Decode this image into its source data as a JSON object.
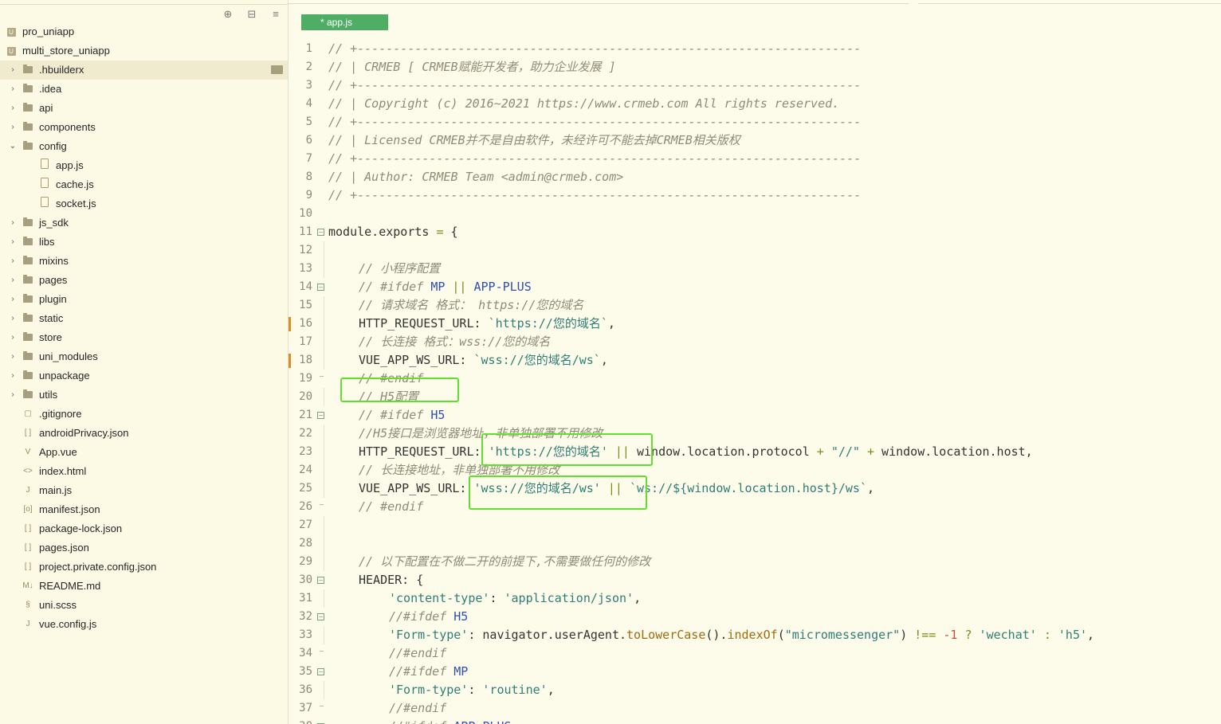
{
  "sidebar": {
    "tools": [
      "⊕",
      "⊟",
      "≡"
    ],
    "tree": [
      {
        "label": "pro_uniapp",
        "type": "project",
        "depth": 0
      },
      {
        "label": "multi_store_uniapp",
        "type": "project",
        "depth": 0
      },
      {
        "label": ".hbuilderx",
        "type": "folder",
        "depth": 1,
        "selected": true
      },
      {
        "label": ".idea",
        "type": "folder",
        "depth": 1
      },
      {
        "label": "api",
        "type": "folder",
        "depth": 1
      },
      {
        "label": "components",
        "type": "folder",
        "depth": 1
      },
      {
        "label": "config",
        "type": "folder",
        "depth": 1,
        "open": true
      },
      {
        "label": "app.js",
        "type": "file",
        "depth": 2
      },
      {
        "label": "cache.js",
        "type": "file",
        "depth": 2
      },
      {
        "label": "socket.js",
        "type": "file",
        "depth": 2
      },
      {
        "label": "js_sdk",
        "type": "folder",
        "depth": 1
      },
      {
        "label": "libs",
        "type": "folder",
        "depth": 1
      },
      {
        "label": "mixins",
        "type": "folder",
        "depth": 1
      },
      {
        "label": "pages",
        "type": "folder",
        "depth": 1
      },
      {
        "label": "plugin",
        "type": "folder",
        "depth": 1
      },
      {
        "label": "static",
        "type": "folder",
        "depth": 1
      },
      {
        "label": "store",
        "type": "folder",
        "depth": 1
      },
      {
        "label": "uni_modules",
        "type": "folder",
        "depth": 1
      },
      {
        "label": "unpackage",
        "type": "folder",
        "depth": 1
      },
      {
        "label": "utils",
        "type": "folder",
        "depth": 1
      },
      {
        "label": ".gitignore",
        "type": "file",
        "depth": 1,
        "icon": "▢"
      },
      {
        "label": "androidPrivacy.json",
        "type": "file",
        "depth": 1,
        "icon": "[ ]"
      },
      {
        "label": "App.vue",
        "type": "file",
        "depth": 1,
        "icon": "V"
      },
      {
        "label": "index.html",
        "type": "file",
        "depth": 1,
        "icon": "<>"
      },
      {
        "label": "main.js",
        "type": "file",
        "depth": 1,
        "icon": "J"
      },
      {
        "label": "manifest.json",
        "type": "file",
        "depth": 1,
        "icon": "[o]"
      },
      {
        "label": "package-lock.json",
        "type": "file",
        "depth": 1,
        "icon": "[ ]"
      },
      {
        "label": "pages.json",
        "type": "file",
        "depth": 1,
        "icon": "[ ]"
      },
      {
        "label": "project.private.config.json",
        "type": "file",
        "depth": 1,
        "icon": "[ ]"
      },
      {
        "label": "README.md",
        "type": "file",
        "depth": 1,
        "icon": "M↓"
      },
      {
        "label": "uni.scss",
        "type": "file",
        "depth": 1,
        "icon": "§"
      },
      {
        "label": "vue.config.js",
        "type": "file",
        "depth": 1,
        "icon": "J"
      }
    ]
  },
  "editor": {
    "tab_label": "* app.js",
    "lines": [
      {
        "n": "1",
        "indent": 0,
        "tokens": [
          [
            "c",
            "// +----------------------------------------------------------------------"
          ]
        ]
      },
      {
        "n": "2",
        "indent": 0,
        "tokens": [
          [
            "c",
            "// | CRMEB [ CRMEB赋能开发者，助力企业发展 ]"
          ]
        ]
      },
      {
        "n": "3",
        "indent": 0,
        "tokens": [
          [
            "c",
            "// +----------------------------------------------------------------------"
          ]
        ]
      },
      {
        "n": "4",
        "indent": 0,
        "tokens": [
          [
            "c",
            "// | Copyright (c) 2016~2021 https://www.crmeb.com All rights reserved."
          ]
        ]
      },
      {
        "n": "5",
        "indent": 0,
        "tokens": [
          [
            "c",
            "// +----------------------------------------------------------------------"
          ]
        ]
      },
      {
        "n": "6",
        "indent": 0,
        "tokens": [
          [
            "c",
            "// | Licensed CRMEB并不是自由软件，未经许可不能去掉CRMEB相关版权"
          ]
        ]
      },
      {
        "n": "7",
        "indent": 0,
        "tokens": [
          [
            "c",
            "// +----------------------------------------------------------------------"
          ]
        ]
      },
      {
        "n": "8",
        "indent": 0,
        "tokens": [
          [
            "c",
            "// | Author: CRMEB Team <admin@crmeb.com>"
          ]
        ]
      },
      {
        "n": "9",
        "indent": 0,
        "tokens": [
          [
            "c",
            "// +----------------------------------------------------------------------"
          ]
        ]
      },
      {
        "n": "10",
        "indent": 0,
        "tokens": []
      },
      {
        "n": "11",
        "indent": 0,
        "fold": "open",
        "tokens": [
          [
            "t",
            "module.exports "
          ],
          [
            "op",
            "="
          ],
          [
            "t",
            " {"
          ]
        ]
      },
      {
        "n": "12",
        "indent": 0,
        "tokens": []
      },
      {
        "n": "13",
        "indent": 1,
        "tokens": [
          [
            "c",
            "// 小程序配置"
          ]
        ]
      },
      {
        "n": "14",
        "indent": 1,
        "fold": "open",
        "tokens": [
          [
            "pp",
            "// "
          ],
          [
            "pp",
            "#ifdef "
          ],
          [
            "kw",
            "MP "
          ],
          [
            "op",
            "||"
          ],
          [
            "kw",
            " APP-PLUS"
          ]
        ]
      },
      {
        "n": "15",
        "indent": 1,
        "tokens": [
          [
            "c",
            "// 请求域名 格式： https://您的域名"
          ]
        ]
      },
      {
        "n": "16",
        "indent": 1,
        "mark": true,
        "tokens": [
          [
            "t",
            "HTTP_REQUEST_URL: "
          ],
          [
            "s",
            "`https://您的域名`"
          ],
          [
            "t",
            ","
          ]
        ]
      },
      {
        "n": "17",
        "indent": 1,
        "tokens": [
          [
            "c",
            "// 长连接 格式：wss://您的域名"
          ]
        ]
      },
      {
        "n": "18",
        "indent": 1,
        "mark": true,
        "tokens": [
          [
            "t",
            "VUE_APP_WS_URL: "
          ],
          [
            "s",
            "`wss://您的域名/ws`"
          ],
          [
            "t",
            ","
          ]
        ]
      },
      {
        "n": "19",
        "indent": 1,
        "fold": "end",
        "tokens": [
          [
            "c",
            "// #endif"
          ]
        ]
      },
      {
        "n": "20",
        "indent": 1,
        "tokens": [
          [
            "c",
            "// H5配置"
          ]
        ]
      },
      {
        "n": "21",
        "indent": 1,
        "fold": "open",
        "tokens": [
          [
            "pp",
            "// #ifdef "
          ],
          [
            "kw",
            "H5"
          ]
        ]
      },
      {
        "n": "22",
        "indent": 1,
        "tokens": [
          [
            "c",
            "//H5接口是浏览器地址，非单独部署不用修改"
          ]
        ]
      },
      {
        "n": "23",
        "indent": 1,
        "tokens": [
          [
            "t",
            "HTTP_REQUEST_URL: "
          ],
          [
            "s",
            "'https://您的域名'"
          ],
          [
            "op",
            " ||"
          ],
          [
            "t",
            " window.location.protocol "
          ],
          [
            "op",
            "+"
          ],
          [
            "s",
            " \"//\""
          ],
          [
            "op",
            " +"
          ],
          [
            "t",
            " window.location.host,"
          ]
        ]
      },
      {
        "n": "24",
        "indent": 1,
        "tokens": [
          [
            "c",
            "// 长连接地址，非单独部署不用修改"
          ]
        ]
      },
      {
        "n": "25",
        "indent": 1,
        "tokens": [
          [
            "t",
            "VUE_APP_WS_URL: "
          ],
          [
            "s",
            "'wss://您的域名/ws'"
          ],
          [
            "op",
            " ||"
          ],
          [
            "s",
            " `ws://${window.location.host}/ws`"
          ],
          [
            "t",
            ","
          ]
        ]
      },
      {
        "n": "26",
        "indent": 1,
        "fold": "end",
        "tokens": [
          [
            "pp",
            "// #endif"
          ]
        ]
      },
      {
        "n": "27",
        "indent": 0,
        "tokens": []
      },
      {
        "n": "28",
        "indent": 0,
        "tokens": []
      },
      {
        "n": "29",
        "indent": 1,
        "tokens": [
          [
            "c",
            "// 以下配置在不做二开的前提下,不需要做任何的修改"
          ]
        ]
      },
      {
        "n": "30",
        "indent": 1,
        "fold": "open",
        "tokens": [
          [
            "t",
            "HEADER: {"
          ]
        ]
      },
      {
        "n": "31",
        "indent": 2,
        "tokens": [
          [
            "s",
            "'content-type'"
          ],
          [
            "t",
            ": "
          ],
          [
            "s",
            "'application/json'"
          ],
          [
            "t",
            ","
          ]
        ]
      },
      {
        "n": "32",
        "indent": 2,
        "fold": "open",
        "tokens": [
          [
            "pp",
            "//#ifdef "
          ],
          [
            "kw",
            "H5"
          ]
        ]
      },
      {
        "n": "33",
        "indent": 2,
        "tokens": [
          [
            "s",
            "'Form-type'"
          ],
          [
            "t",
            ": navigator.userAgent."
          ],
          [
            "fn",
            "toLowerCase"
          ],
          [
            "t",
            "()."
          ],
          [
            "fn",
            "indexOf"
          ],
          [
            "t",
            "("
          ],
          [
            "s",
            "\"micromessenger\""
          ],
          [
            "t",
            ") "
          ],
          [
            "op",
            "!=="
          ],
          [
            "num",
            " -1"
          ],
          [
            "op",
            " ?"
          ],
          [
            "s",
            " 'wechat'"
          ],
          [
            "op",
            " :"
          ],
          [
            "s",
            " 'h5'"
          ],
          [
            "t",
            ","
          ]
        ]
      },
      {
        "n": "34",
        "indent": 2,
        "fold": "end",
        "tokens": [
          [
            "pp",
            "//#endif"
          ]
        ]
      },
      {
        "n": "35",
        "indent": 2,
        "fold": "open",
        "tokens": [
          [
            "pp",
            "//#ifdef "
          ],
          [
            "kw",
            "MP"
          ]
        ]
      },
      {
        "n": "36",
        "indent": 2,
        "tokens": [
          [
            "s",
            "'Form-type'"
          ],
          [
            "t",
            ": "
          ],
          [
            "s",
            "'routine'"
          ],
          [
            "t",
            ","
          ]
        ]
      },
      {
        "n": "37",
        "indent": 2,
        "fold": "end",
        "tokens": [
          [
            "pp",
            "//#endif"
          ]
        ]
      },
      {
        "n": "38",
        "indent": 2,
        "fold": "open",
        "tokens": [
          [
            "pp",
            "//#ifdef "
          ],
          [
            "kw",
            "APP-PLUS"
          ]
        ]
      }
    ]
  },
  "colors": {
    "highlight_box": "#5fe02c",
    "tab": "#4fad65",
    "modified_marker": "#e08a2a"
  }
}
